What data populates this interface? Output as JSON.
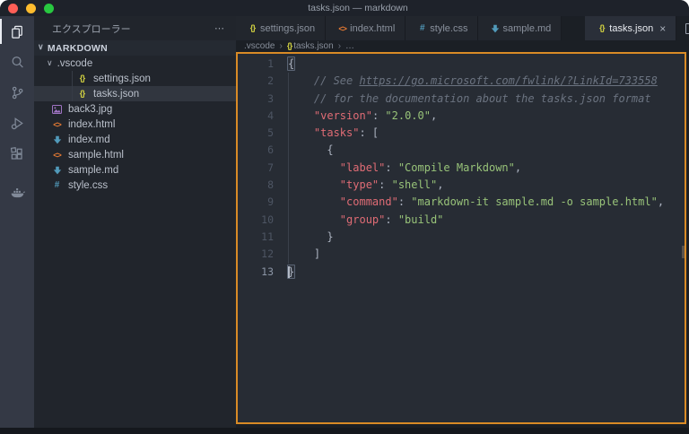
{
  "window": {
    "title": "tasks.json — markdown"
  },
  "colors": {
    "accent_border": "#d98b26",
    "json_icon": "#cbcb41",
    "html_icon": "#e37933",
    "css_icon": "#519aba",
    "markdown_icon": "#519aba",
    "image_icon": "#a074c4",
    "key": "#e06c75",
    "string": "#98c379",
    "comment": "#6b7380"
  },
  "titlebar": {
    "traffic_lights": [
      "close",
      "minimize",
      "zoom"
    ]
  },
  "activity_bar": {
    "items": [
      {
        "name": "explorer",
        "active": true
      },
      {
        "name": "search",
        "active": false
      },
      {
        "name": "source-control",
        "active": false
      },
      {
        "name": "run-debug",
        "active": false
      },
      {
        "name": "extensions",
        "active": false
      },
      {
        "name": "docker",
        "active": false,
        "gap": true
      }
    ]
  },
  "sidebar": {
    "header": {
      "title": "エクスプローラー",
      "menu": "⋯"
    },
    "section": {
      "label": "MARKDOWN",
      "chevron": "∨"
    },
    "tree": [
      {
        "label": ".vscode",
        "kind": "folder",
        "level": 1,
        "expanded": true,
        "chevron": "∨"
      },
      {
        "label": "settings.json",
        "icon": "json",
        "level": 2,
        "selected": false
      },
      {
        "label": "tasks.json",
        "icon": "json",
        "level": 2,
        "selected": true
      },
      {
        "label": "back3.jpg",
        "icon": "image",
        "level": 1,
        "selected": false
      },
      {
        "label": "index.html",
        "icon": "html",
        "level": 1,
        "selected": false
      },
      {
        "label": "index.md",
        "icon": "markdown",
        "level": 1,
        "selected": false
      },
      {
        "label": "sample.html",
        "icon": "html",
        "level": 1,
        "selected": false
      },
      {
        "label": "sample.md",
        "icon": "markdown",
        "level": 1,
        "selected": false
      },
      {
        "label": "style.css",
        "icon": "css",
        "level": 1,
        "selected": false
      }
    ]
  },
  "editor": {
    "tabs": [
      {
        "label": "settings.json",
        "icon": "json",
        "active": false
      },
      {
        "label": "index.html",
        "icon": "html",
        "active": false
      },
      {
        "label": "style.css",
        "icon": "css",
        "active": false
      },
      {
        "label": "sample.md",
        "icon": "markdown",
        "active": false
      },
      {
        "label": "tasks.json",
        "icon": "json",
        "active": true,
        "close_label": "×"
      }
    ],
    "tab_actions": {
      "split_editor": "split-editor",
      "more": "⋯"
    },
    "breadcrumb": {
      "separator": "›",
      "items": [
        {
          "label": ".vscode"
        },
        {
          "label": "tasks.json",
          "icon": "json"
        },
        {
          "label": "…"
        }
      ]
    },
    "code": {
      "language": "jsonc",
      "lines": [
        {
          "n": "1",
          "indent": 0,
          "tokens": [
            {
              "t": "pun",
              "v": "{",
              "match": true
            }
          ]
        },
        {
          "n": "2",
          "indent": 4,
          "tokens": [
            {
              "t": "com",
              "v": "// See "
            },
            {
              "t": "lnk",
              "v": "https://go.microsoft.com/fwlink/?LinkId=733558"
            }
          ]
        },
        {
          "n": "3",
          "indent": 4,
          "tokens": [
            {
              "t": "com",
              "v": "// for the documentation about the tasks.json format"
            }
          ]
        },
        {
          "n": "4",
          "indent": 4,
          "tokens": [
            {
              "t": "key",
              "v": "\"version\""
            },
            {
              "t": "pun",
              "v": ": "
            },
            {
              "t": "str",
              "v": "\"2.0.0\""
            },
            {
              "t": "pun",
              "v": ","
            }
          ]
        },
        {
          "n": "5",
          "indent": 4,
          "tokens": [
            {
              "t": "key",
              "v": "\"tasks\""
            },
            {
              "t": "pun",
              "v": ": ["
            }
          ]
        },
        {
          "n": "6",
          "indent": 6,
          "tokens": [
            {
              "t": "pun",
              "v": "{"
            }
          ]
        },
        {
          "n": "7",
          "indent": 8,
          "tokens": [
            {
              "t": "key",
              "v": "\"label\""
            },
            {
              "t": "pun",
              "v": ": "
            },
            {
              "t": "str",
              "v": "\"Compile Markdown\""
            },
            {
              "t": "pun",
              "v": ","
            }
          ]
        },
        {
          "n": "8",
          "indent": 8,
          "tokens": [
            {
              "t": "key",
              "v": "\"type\""
            },
            {
              "t": "pun",
              "v": ": "
            },
            {
              "t": "str",
              "v": "\"shell\""
            },
            {
              "t": "pun",
              "v": ","
            }
          ]
        },
        {
          "n": "9",
          "indent": 8,
          "tokens": [
            {
              "t": "key",
              "v": "\"command\""
            },
            {
              "t": "pun",
              "v": ": "
            },
            {
              "t": "str",
              "v": "\"markdown-it sample.md -o sample.html\""
            },
            {
              "t": "pun",
              "v": ","
            }
          ]
        },
        {
          "n": "10",
          "indent": 8,
          "tokens": [
            {
              "t": "key",
              "v": "\"group\""
            },
            {
              "t": "pun",
              "v": ": "
            },
            {
              "t": "str",
              "v": "\"build\""
            }
          ]
        },
        {
          "n": "11",
          "indent": 6,
          "tokens": [
            {
              "t": "pun",
              "v": "}"
            }
          ]
        },
        {
          "n": "12",
          "indent": 4,
          "tokens": [
            {
              "t": "pun",
              "v": "]"
            }
          ]
        },
        {
          "n": "13",
          "indent": 0,
          "active": true,
          "tokens": [
            {
              "t": "cursor"
            },
            {
              "t": "pun",
              "v": "}",
              "match": true
            }
          ]
        }
      ]
    }
  }
}
